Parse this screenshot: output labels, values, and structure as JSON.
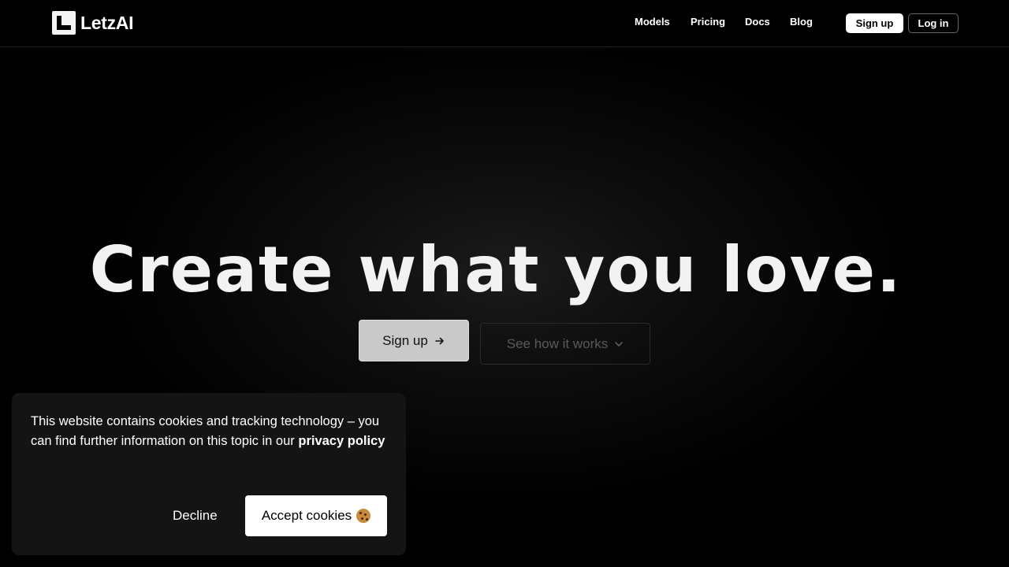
{
  "brand": {
    "name": "LetzAI",
    "logo_icon": "letzai-logo-icon"
  },
  "nav": {
    "links": [
      {
        "label": "Models"
      },
      {
        "label": "Pricing"
      },
      {
        "label": "Docs"
      },
      {
        "label": "Blog"
      }
    ],
    "signup_label": "Sign up",
    "login_label": "Log in"
  },
  "hero": {
    "title": "Create what you love.",
    "primary_cta": "Sign up",
    "primary_cta_icon": "arrow-right-icon",
    "secondary_cta": "See how it works",
    "secondary_cta_icon": "chevron-down-icon"
  },
  "cookie_banner": {
    "text": "This website contains cookies and tracking technology – you can find further information on this topic in our ",
    "link_label": "privacy policy",
    "decline_label": "Decline",
    "accept_label": "Accept cookies",
    "accept_icon": "cookie-icon"
  },
  "colors": {
    "background": "#000000",
    "accent": "#ffffff",
    "banner_bg": "#141414"
  }
}
